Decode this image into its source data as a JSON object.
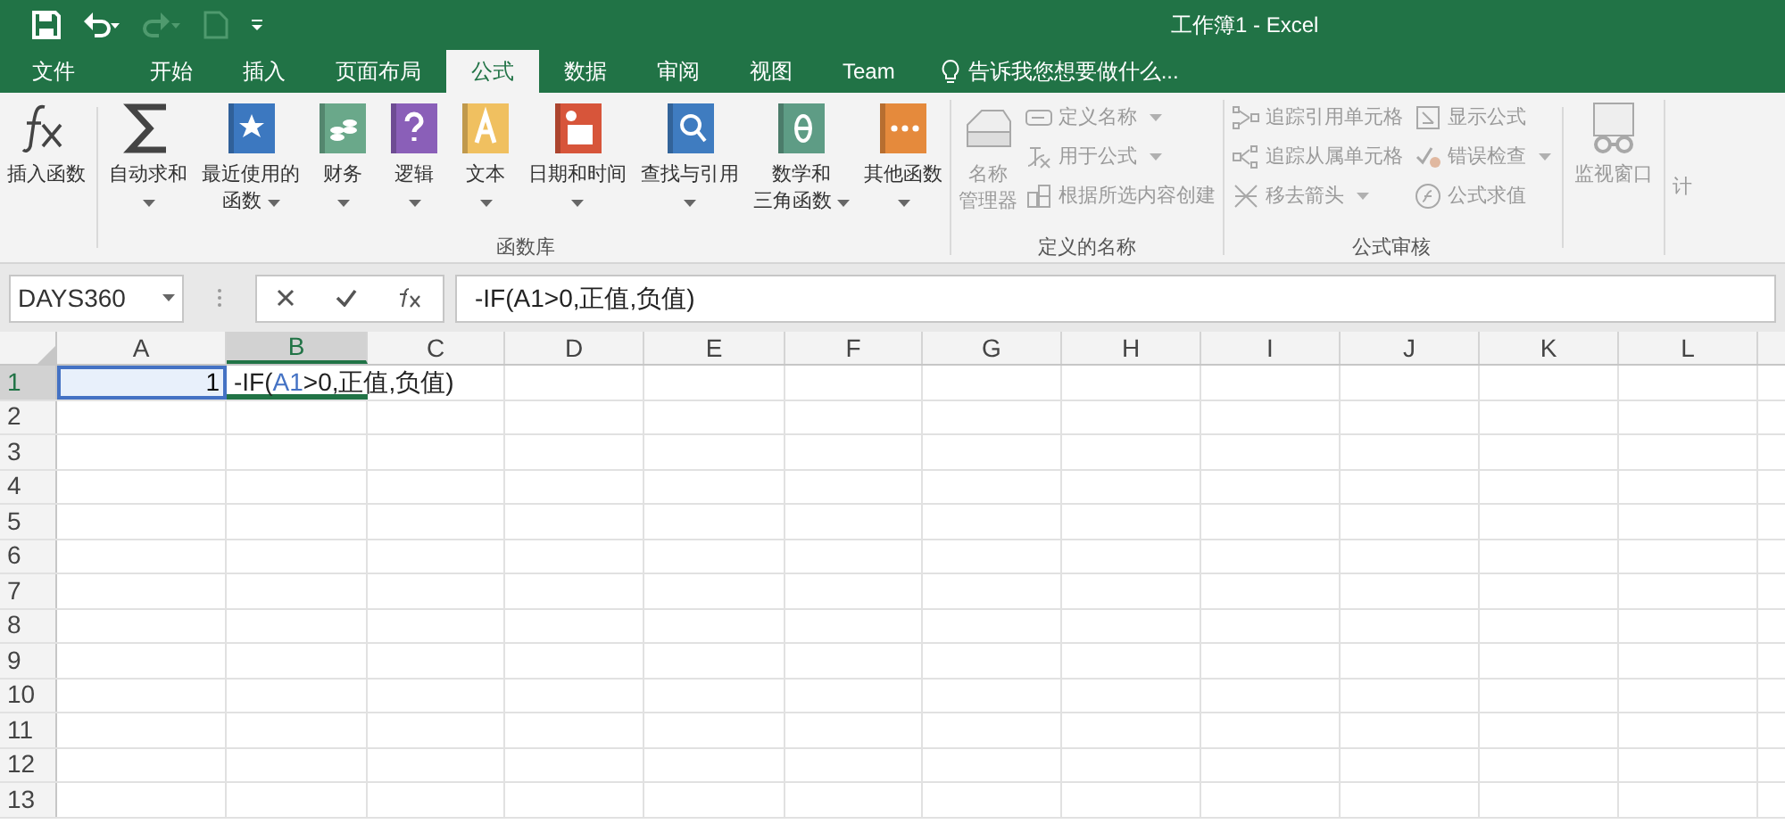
{
  "window": {
    "title": "工作簿1 - Excel"
  },
  "quick_access": [
    {
      "kind": "save",
      "disabled": false
    },
    {
      "kind": "undo",
      "disabled": false
    },
    {
      "kind": "redo",
      "disabled": true
    },
    {
      "kind": "new",
      "disabled": true
    },
    {
      "kind": "customize",
      "disabled": false
    }
  ],
  "tabs": [
    {
      "label": "文件",
      "selected": false
    },
    {
      "label": "开始",
      "selected": false
    },
    {
      "label": "插入",
      "selected": false
    },
    {
      "label": "页面布局",
      "selected": false
    },
    {
      "label": "公式",
      "selected": true
    },
    {
      "label": "数据",
      "selected": false
    },
    {
      "label": "审阅",
      "selected": false
    },
    {
      "label": "视图",
      "selected": false
    },
    {
      "label": "Team",
      "selected": false
    }
  ],
  "tell_me": {
    "placeholder": "告诉我您想要做什么..."
  },
  "ribbon": {
    "insert_function": {
      "label": "插入函数"
    },
    "function_library": {
      "label": "函数库",
      "buttons": [
        {
          "lines": [
            "自动求和"
          ],
          "dropdown": true
        },
        {
          "lines": [
            "最近使用的",
            "函数"
          ],
          "dropdown": true
        },
        {
          "lines": [
            "财务"
          ],
          "dropdown": true
        },
        {
          "lines": [
            "逻辑"
          ],
          "dropdown": true
        },
        {
          "lines": [
            "文本"
          ],
          "dropdown": true
        },
        {
          "lines": [
            "日期和时间"
          ],
          "dropdown": true
        },
        {
          "lines": [
            "查找与引用"
          ],
          "dropdown": true
        },
        {
          "lines": [
            "数学和",
            "三角函数"
          ],
          "dropdown": true
        },
        {
          "lines": [
            "其他函数"
          ],
          "dropdown": true
        }
      ]
    },
    "defined_names": {
      "label": "定义的名称",
      "manager": {
        "lines": [
          "名称",
          "管理器"
        ],
        "disabled": true
      },
      "items": [
        {
          "label": "定义名称",
          "dropdown": true,
          "disabled": true
        },
        {
          "label": "用于公式",
          "dropdown": true,
          "disabled": true
        },
        {
          "label": "根据所选内容创建",
          "dropdown": false,
          "disabled": true
        }
      ]
    },
    "formula_auditing": {
      "label": "公式审核",
      "items": [
        {
          "label": "追踪引用单元格",
          "dropdown": false,
          "disabled": true
        },
        {
          "label": "追踪从属单元格",
          "dropdown": false,
          "disabled": true
        },
        {
          "label": "移去箭头",
          "dropdown": true,
          "disabled": true
        },
        {
          "label": "显示公式",
          "dropdown": false,
          "disabled": true
        },
        {
          "label": "错误检查",
          "dropdown": true,
          "disabled": true
        },
        {
          "label": "公式求值",
          "dropdown": false,
          "disabled": true
        }
      ]
    },
    "watch_window": {
      "lines": [
        "监视窗口"
      ],
      "disabled": true
    },
    "cut_off_group": {
      "label": "计"
    }
  },
  "formula_bar": {
    "name_box": "DAYS360",
    "formula": "-IF(A1>0,正值,负值)"
  },
  "grid": {
    "columns": [
      {
        "label": "A",
        "selected": false
      },
      {
        "label": "B",
        "selected": true
      },
      {
        "label": "C",
        "selected": false
      },
      {
        "label": "D",
        "selected": false
      },
      {
        "label": "E",
        "selected": false
      },
      {
        "label": "F",
        "selected": false
      },
      {
        "label": "G",
        "selected": false
      },
      {
        "label": "H",
        "selected": false
      },
      {
        "label": "I",
        "selected": false
      },
      {
        "label": "J",
        "selected": false
      },
      {
        "label": "K",
        "selected": false
      },
      {
        "label": "L",
        "selected": false
      }
    ],
    "rows": [
      {
        "label": "1",
        "selected": true,
        "cells": [
          {
            "kind": "number",
            "value": "1",
            "referenced": true,
            "active": false
          },
          {
            "kind": "formula",
            "parts": [
              {
                "text": "-IF(",
                "ref": false
              },
              {
                "text": "A1",
                "ref": true
              },
              {
                "text": ">0,正值,负值)",
                "ref": false
              }
            ],
            "referenced": false,
            "active": true
          }
        ]
      },
      {
        "label": "2",
        "selected": false
      },
      {
        "label": "3",
        "selected": false
      },
      {
        "label": "4",
        "selected": false
      },
      {
        "label": "5",
        "selected": false
      },
      {
        "label": "6",
        "selected": false
      },
      {
        "label": "7",
        "selected": false
      },
      {
        "label": "8",
        "selected": false
      },
      {
        "label": "9",
        "selected": false
      },
      {
        "label": "10",
        "selected": false
      },
      {
        "label": "11",
        "selected": false
      },
      {
        "label": "12",
        "selected": false
      },
      {
        "label": "13",
        "selected": false
      }
    ]
  }
}
